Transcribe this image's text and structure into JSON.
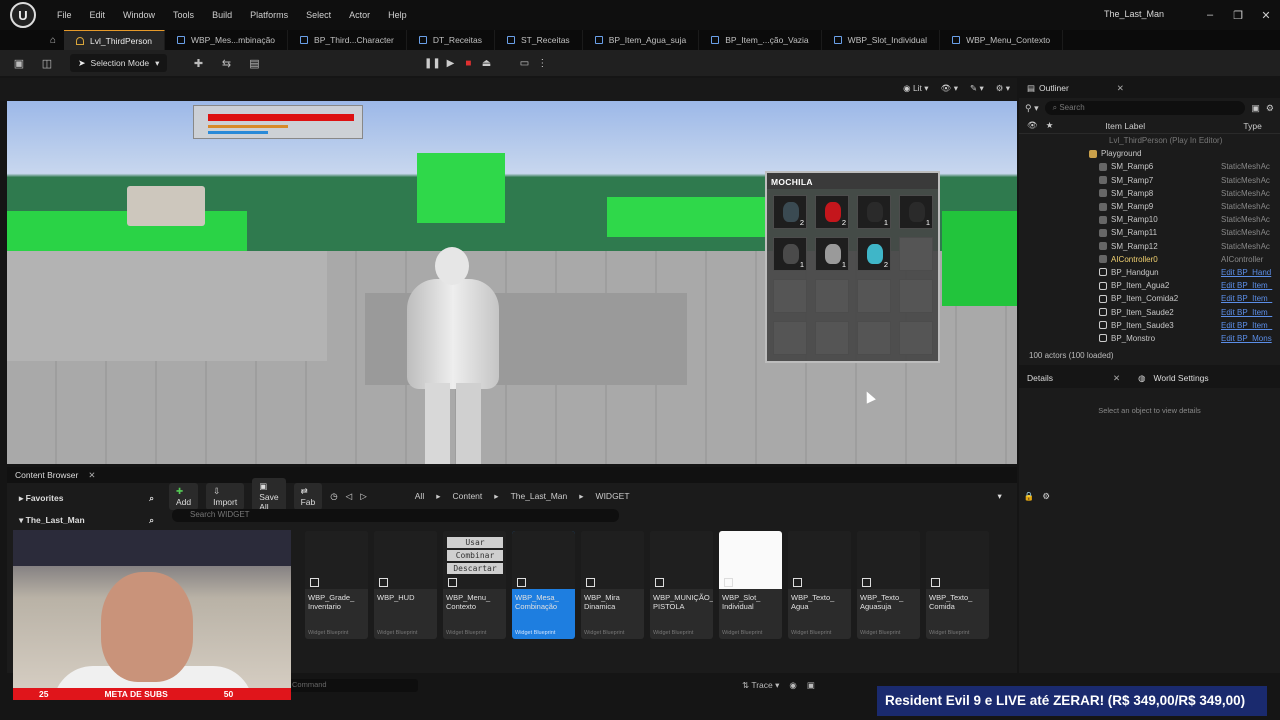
{
  "menubar": {
    "items": [
      "File",
      "Edit",
      "Window",
      "Tools",
      "Build",
      "Platforms",
      "Select",
      "Actor",
      "Help"
    ],
    "title": "The_Last_Man"
  },
  "tabs": [
    {
      "label": "Lvl_ThirdPerson",
      "active": true
    },
    {
      "label": "WBP_Mes...mbinação"
    },
    {
      "label": "BP_Third...Character"
    },
    {
      "label": "DT_Receitas"
    },
    {
      "label": "ST_Receitas"
    },
    {
      "label": "BP_Item_Agua_suja"
    },
    {
      "label": "BP_Item_...ção_Vazia"
    },
    {
      "label": "WBP_Slot_Individual"
    },
    {
      "label": "WBP_Menu_Contexto"
    }
  ],
  "toolbar": {
    "mode": "Selection Mode"
  },
  "viewport": {
    "lit_label": "Lit",
    "inventory": {
      "title": "MOCHILA",
      "slots": [
        {
          "qty": "2",
          "color": "#3a4a52"
        },
        {
          "qty": "2",
          "color": "#c4161c"
        },
        {
          "qty": "1",
          "color": "#2a2a2a"
        },
        {
          "qty": "1",
          "color": "#2a2a2a"
        },
        {
          "qty": "1",
          "color": "#4a4a4a"
        },
        {
          "qty": "1",
          "color": "#9a9a9a"
        },
        {
          "qty": "2",
          "color": "#3fb6c8"
        },
        {
          "qty": "",
          "color": ""
        },
        {
          "qty": "",
          "color": ""
        },
        {
          "qty": "",
          "color": ""
        },
        {
          "qty": "",
          "color": ""
        },
        {
          "qty": "",
          "color": ""
        },
        {
          "qty": "",
          "color": ""
        },
        {
          "qty": "",
          "color": ""
        },
        {
          "qty": "",
          "color": ""
        },
        {
          "qty": "",
          "color": ""
        }
      ]
    }
  },
  "outliner": {
    "title": "Outliner",
    "search_placeholder": "Search",
    "col_label": "Item Label",
    "col_type": "Type",
    "rows": [
      {
        "name": "Lvl_ThirdPerson (Play In Editor)",
        "type": "",
        "muted": true
      },
      {
        "name": "Playground",
        "type": "",
        "folder": true
      },
      {
        "name": "SM_Ramp6",
        "type": "StaticMeshAc"
      },
      {
        "name": "SM_Ramp7",
        "type": "StaticMeshAc"
      },
      {
        "name": "SM_Ramp8",
        "type": "StaticMeshAc"
      },
      {
        "name": "SM_Ramp9",
        "type": "StaticMeshAc"
      },
      {
        "name": "SM_Ramp10",
        "type": "StaticMeshAc"
      },
      {
        "name": "SM_Ramp11",
        "type": "StaticMeshAc"
      },
      {
        "name": "SM_Ramp12",
        "type": "StaticMeshAc"
      },
      {
        "name": "AIController0",
        "type": "AIController"
      },
      {
        "name": "BP_Handgun",
        "type": "Edit BP_Hand",
        "link": true
      },
      {
        "name": "BP_Item_Agua2",
        "type": "Edit BP_Item_",
        "link": true
      },
      {
        "name": "BP_Item_Comida2",
        "type": "Edit BP_Item_",
        "link": true
      },
      {
        "name": "BP_Item_Saude2",
        "type": "Edit BP_Item_",
        "link": true
      },
      {
        "name": "BP_Item_Saude3",
        "type": "Edit BP_Item_",
        "link": true
      },
      {
        "name": "BP_Monstro",
        "type": "Edit BP_Mons",
        "link": true
      }
    ],
    "footer": "100 actors (100 loaded)"
  },
  "details": {
    "tab1": "Details",
    "tab2": "World Settings",
    "empty_msg": "Select an object to view details"
  },
  "content_browser": {
    "title": "Content Browser",
    "add": "Add",
    "import": "Import",
    "save_all": "Save All",
    "fab": "Fab",
    "crumbs": [
      "All",
      "Content",
      "The_Last_Man",
      "WIDGET"
    ],
    "favorites": "Favorites",
    "root": "The_Last_Man",
    "search_placeholder": "Search WIDGET",
    "menu_thumb": [
      "Usar",
      "Combinar",
      "Descartar"
    ],
    "assets": [
      {
        "name": "WBP_Grade_ Inventario",
        "kind": "Widget Blueprint"
      },
      {
        "name": "WBP_HUD",
        "kind": "Widget Blueprint"
      },
      {
        "name": "WBP_Menu_ Contexto",
        "kind": "Widget Blueprint"
      },
      {
        "name": "WBP_Mesa_ Combinação",
        "kind": "Widget Blueprint",
        "selected": true
      },
      {
        "name": "WBP_Mira Dinamica",
        "kind": "Widget Blueprint"
      },
      {
        "name": "WBP_MUNIÇÃO_ PISTOLA",
        "kind": "Widget Blueprint"
      },
      {
        "name": "WBP_Slot_ Individual",
        "kind": "Widget Blueprint",
        "white": true
      },
      {
        "name": "WBP_Texto_ Agua",
        "kind": "Widget Blueprint"
      },
      {
        "name": "WBP_Texto_ Aguasuja",
        "kind": "Widget Blueprint"
      },
      {
        "name": "WBP_Texto_ Comida",
        "kind": "Widget Blueprint"
      }
    ]
  },
  "statusbar": {
    "cmd_placeholder": "Command",
    "trace": "Trace"
  },
  "overlay": {
    "subs_min": "25",
    "subs_label": "META DE SUBS",
    "subs_max": "50",
    "promo": "Resident Evil 9 e LIVE até ZERAR! (R$ 349,00/R$ 349,00)"
  }
}
